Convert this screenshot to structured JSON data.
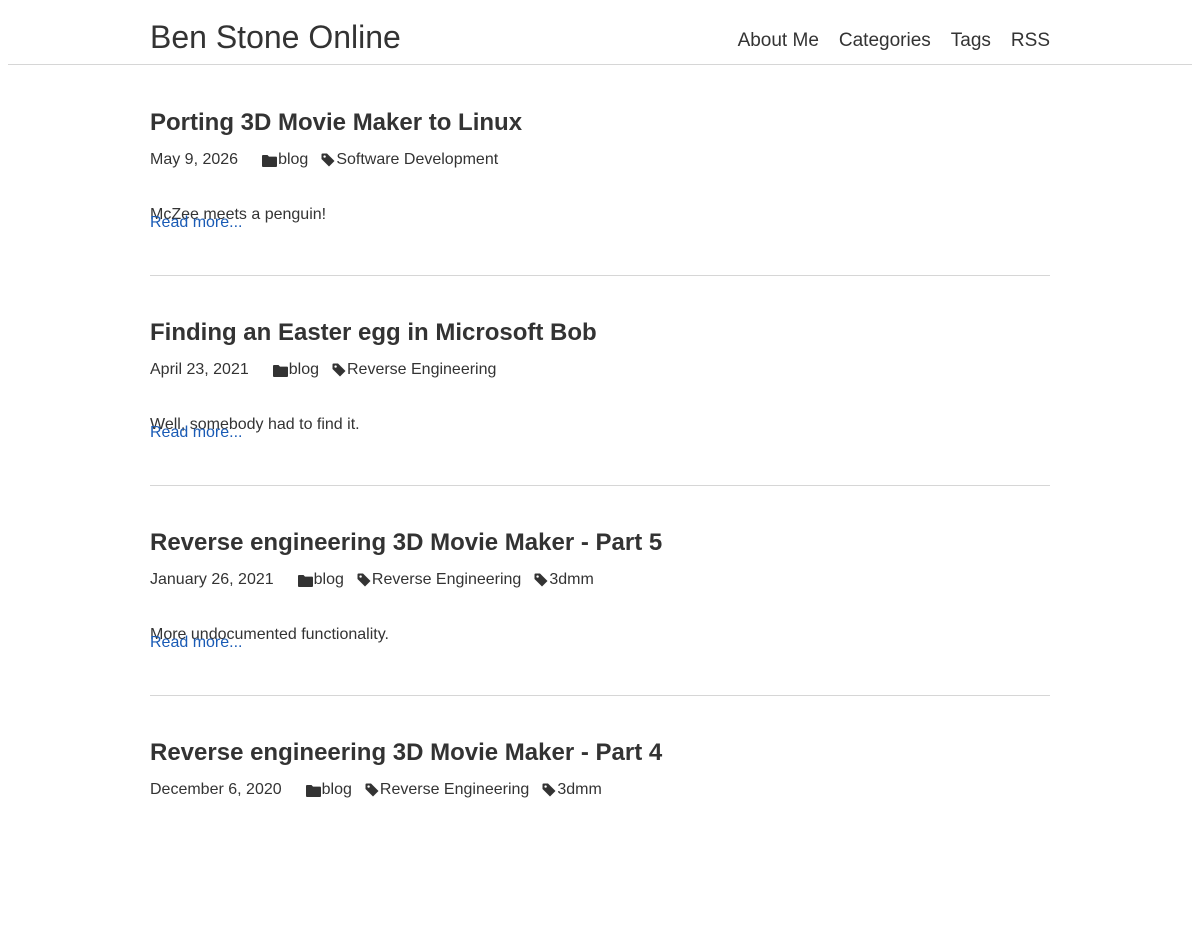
{
  "site": {
    "title": "Ben Stone Online",
    "nav": [
      "About Me",
      "Categories",
      "Tags",
      "RSS"
    ]
  },
  "colors": {
    "text": "#333333",
    "link": "#1a5bb5",
    "divider": "#d6d6d6"
  },
  "icons": {
    "category": "folder-icon",
    "tag": "tag-icon"
  },
  "posts": [
    {
      "title": "Porting 3D Movie Maker to Linux",
      "date": "May 9, 2026",
      "category": "blog",
      "tags": [
        "Software Development"
      ],
      "summary": "McZee meets a penguin!",
      "read_more": "Read more..."
    },
    {
      "title": "Finding an Easter egg in Microsoft Bob",
      "date": "April 23, 2021",
      "category": "blog",
      "tags": [
        "Reverse Engineering"
      ],
      "summary": "Well, somebody had to find it.",
      "read_more": "Read more..."
    },
    {
      "title": "Reverse engineering 3D Movie Maker - Part 5",
      "date": "January 26, 2021",
      "category": "blog",
      "tags": [
        "Reverse Engineering",
        "3dmm"
      ],
      "summary": "More undocumented functionality.",
      "read_more": "Read more..."
    },
    {
      "title": "Reverse engineering 3D Movie Maker - Part 4",
      "date": "December 6, 2020",
      "category": "blog",
      "tags": [
        "Reverse Engineering",
        "3dmm"
      ],
      "summary": "",
      "read_more": ""
    }
  ]
}
